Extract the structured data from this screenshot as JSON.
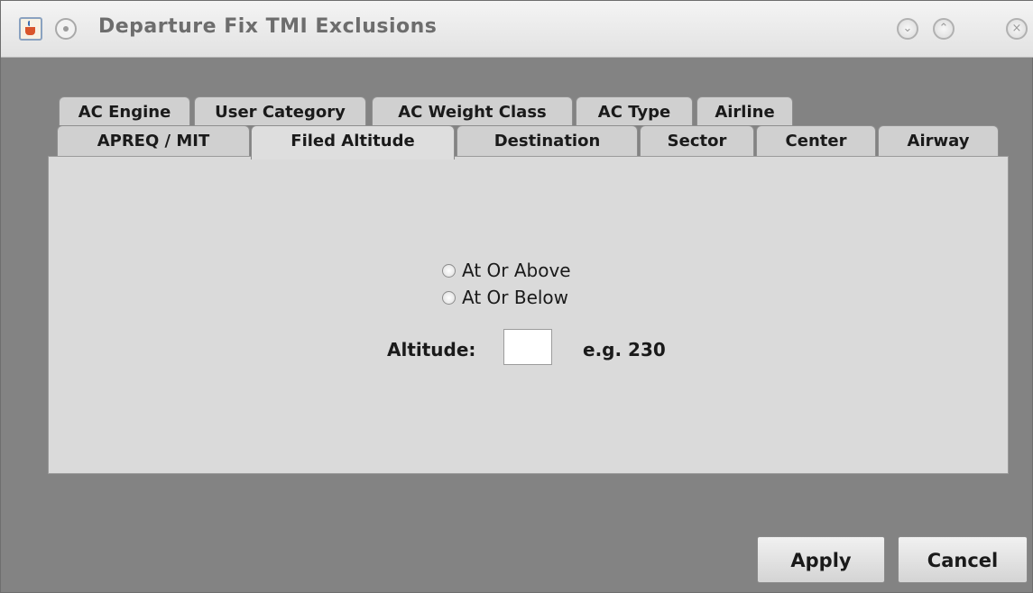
{
  "window": {
    "title": "Departure Fix TMI Exclusions"
  },
  "tabs": {
    "row_back": [
      {
        "label": "AC Engine"
      },
      {
        "label": "User Category"
      },
      {
        "label": "AC Weight Class"
      },
      {
        "label": "AC Type"
      },
      {
        "label": "Airline"
      }
    ],
    "row_front": [
      {
        "label": "APREQ / MIT"
      },
      {
        "label": "Filed Altitude"
      },
      {
        "label": "Destination"
      },
      {
        "label": "Sector"
      },
      {
        "label": "Center"
      },
      {
        "label": "Airway"
      }
    ],
    "active": "Filed Altitude"
  },
  "filed_altitude": {
    "options": [
      {
        "label": "At Or Above",
        "selected": false
      },
      {
        "label": "At Or Below",
        "selected": false
      }
    ],
    "altitude_label": "Altitude:",
    "altitude_value": "",
    "hint": "e.g. 230"
  },
  "buttons": {
    "apply": "Apply",
    "cancel": "Cancel"
  },
  "colors": {
    "window_background": "#838383",
    "panel_background": "#dadada",
    "tab_background": "#d0d0d0"
  },
  "icons": {
    "app": "java-app-icon",
    "window_menu": "window-menu-icon",
    "minimize": "minimize-icon",
    "maximize": "maximize-icon",
    "close": "close-icon"
  }
}
